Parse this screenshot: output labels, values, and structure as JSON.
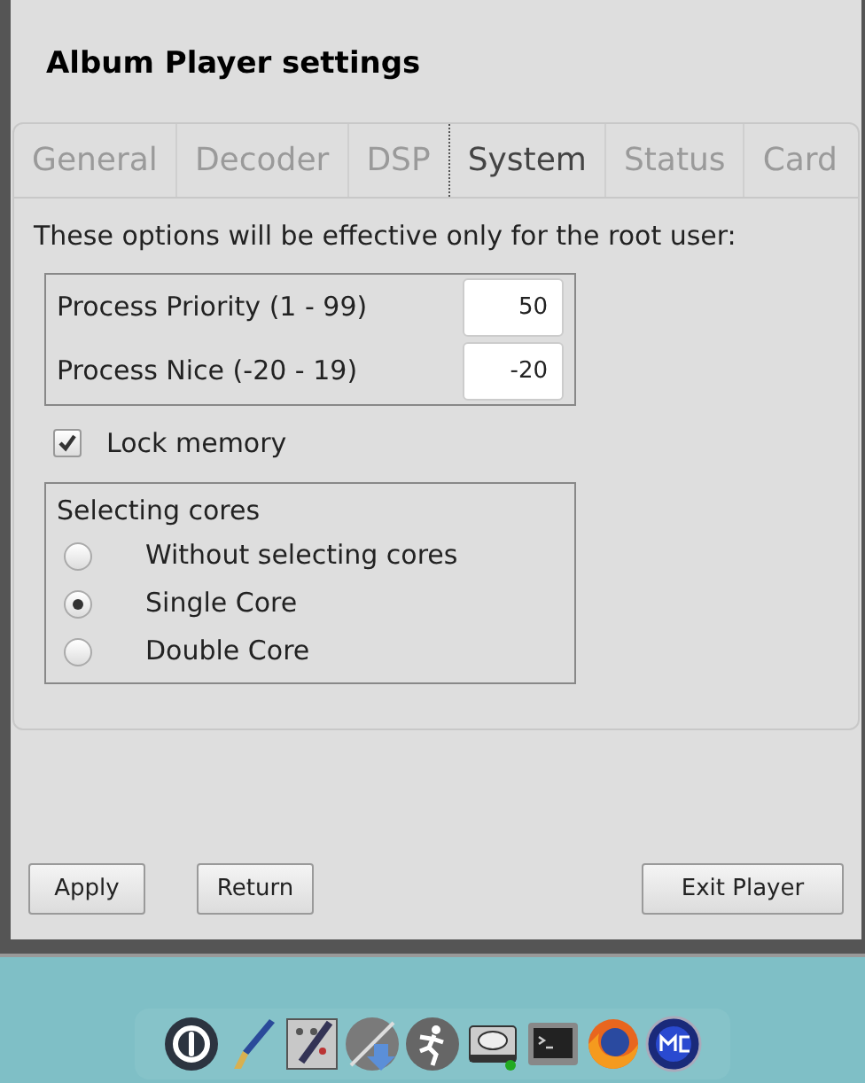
{
  "window": {
    "title": "Album Player settings"
  },
  "tabs": [
    {
      "label": "General",
      "selected": false
    },
    {
      "label": "Decoder",
      "selected": false
    },
    {
      "label": "DSP",
      "selected": false
    },
    {
      "label": "System",
      "selected": true
    },
    {
      "label": "Status",
      "selected": false
    },
    {
      "label": "Card",
      "selected": false
    }
  ],
  "notice": "These options will be effective only for the root user:",
  "fields": [
    {
      "label": "Process Priority (1 - 99)",
      "value": "50"
    },
    {
      "label": "Process Nice (-20 - 19)",
      "value": "-20"
    }
  ],
  "lock_memory": {
    "label": "Lock memory",
    "checked": true
  },
  "cores": {
    "title": "Selecting cores",
    "options": [
      {
        "label": "Without selecting cores",
        "selected": false
      },
      {
        "label": "Single Core",
        "selected": true
      },
      {
        "label": "Double Core",
        "selected": false
      }
    ]
  },
  "buttons": {
    "left": [
      "Apply",
      "Return"
    ],
    "right": [
      "Exit Player"
    ]
  },
  "dock": [
    {
      "kind": "power"
    },
    {
      "kind": "brush"
    },
    {
      "kind": "tools"
    },
    {
      "kind": "download"
    },
    {
      "kind": "runner"
    },
    {
      "kind": "disk"
    },
    {
      "kind": "terminal"
    },
    {
      "kind": "browser"
    },
    {
      "kind": "commander"
    }
  ]
}
